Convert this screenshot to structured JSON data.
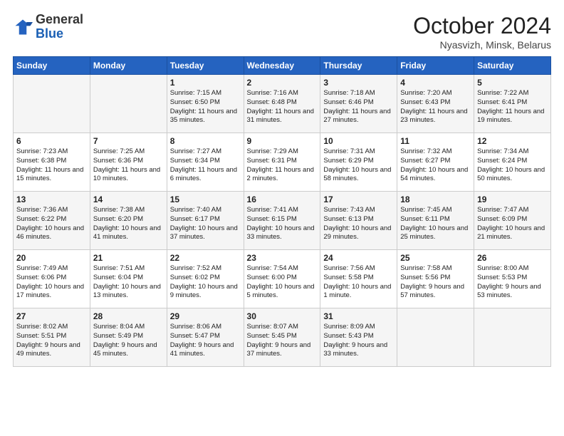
{
  "header": {
    "logo_general": "General",
    "logo_blue": "Blue",
    "month_title": "October 2024",
    "location": "Nyasvizh, Minsk, Belarus"
  },
  "days_of_week": [
    "Sunday",
    "Monday",
    "Tuesday",
    "Wednesday",
    "Thursday",
    "Friday",
    "Saturday"
  ],
  "weeks": [
    [
      {
        "day": "",
        "info": ""
      },
      {
        "day": "",
        "info": ""
      },
      {
        "day": "1",
        "info": "Sunrise: 7:15 AM\nSunset: 6:50 PM\nDaylight: 11 hours and 35 minutes."
      },
      {
        "day": "2",
        "info": "Sunrise: 7:16 AM\nSunset: 6:48 PM\nDaylight: 11 hours and 31 minutes."
      },
      {
        "day": "3",
        "info": "Sunrise: 7:18 AM\nSunset: 6:46 PM\nDaylight: 11 hours and 27 minutes."
      },
      {
        "day": "4",
        "info": "Sunrise: 7:20 AM\nSunset: 6:43 PM\nDaylight: 11 hours and 23 minutes."
      },
      {
        "day": "5",
        "info": "Sunrise: 7:22 AM\nSunset: 6:41 PM\nDaylight: 11 hours and 19 minutes."
      }
    ],
    [
      {
        "day": "6",
        "info": "Sunrise: 7:23 AM\nSunset: 6:38 PM\nDaylight: 11 hours and 15 minutes."
      },
      {
        "day": "7",
        "info": "Sunrise: 7:25 AM\nSunset: 6:36 PM\nDaylight: 11 hours and 10 minutes."
      },
      {
        "day": "8",
        "info": "Sunrise: 7:27 AM\nSunset: 6:34 PM\nDaylight: 11 hours and 6 minutes."
      },
      {
        "day": "9",
        "info": "Sunrise: 7:29 AM\nSunset: 6:31 PM\nDaylight: 11 hours and 2 minutes."
      },
      {
        "day": "10",
        "info": "Sunrise: 7:31 AM\nSunset: 6:29 PM\nDaylight: 10 hours and 58 minutes."
      },
      {
        "day": "11",
        "info": "Sunrise: 7:32 AM\nSunset: 6:27 PM\nDaylight: 10 hours and 54 minutes."
      },
      {
        "day": "12",
        "info": "Sunrise: 7:34 AM\nSunset: 6:24 PM\nDaylight: 10 hours and 50 minutes."
      }
    ],
    [
      {
        "day": "13",
        "info": "Sunrise: 7:36 AM\nSunset: 6:22 PM\nDaylight: 10 hours and 46 minutes."
      },
      {
        "day": "14",
        "info": "Sunrise: 7:38 AM\nSunset: 6:20 PM\nDaylight: 10 hours and 41 minutes."
      },
      {
        "day": "15",
        "info": "Sunrise: 7:40 AM\nSunset: 6:17 PM\nDaylight: 10 hours and 37 minutes."
      },
      {
        "day": "16",
        "info": "Sunrise: 7:41 AM\nSunset: 6:15 PM\nDaylight: 10 hours and 33 minutes."
      },
      {
        "day": "17",
        "info": "Sunrise: 7:43 AM\nSunset: 6:13 PM\nDaylight: 10 hours and 29 minutes."
      },
      {
        "day": "18",
        "info": "Sunrise: 7:45 AM\nSunset: 6:11 PM\nDaylight: 10 hours and 25 minutes."
      },
      {
        "day": "19",
        "info": "Sunrise: 7:47 AM\nSunset: 6:09 PM\nDaylight: 10 hours and 21 minutes."
      }
    ],
    [
      {
        "day": "20",
        "info": "Sunrise: 7:49 AM\nSunset: 6:06 PM\nDaylight: 10 hours and 17 minutes."
      },
      {
        "day": "21",
        "info": "Sunrise: 7:51 AM\nSunset: 6:04 PM\nDaylight: 10 hours and 13 minutes."
      },
      {
        "day": "22",
        "info": "Sunrise: 7:52 AM\nSunset: 6:02 PM\nDaylight: 10 hours and 9 minutes."
      },
      {
        "day": "23",
        "info": "Sunrise: 7:54 AM\nSunset: 6:00 PM\nDaylight: 10 hours and 5 minutes."
      },
      {
        "day": "24",
        "info": "Sunrise: 7:56 AM\nSunset: 5:58 PM\nDaylight: 10 hours and 1 minute."
      },
      {
        "day": "25",
        "info": "Sunrise: 7:58 AM\nSunset: 5:56 PM\nDaylight: 9 hours and 57 minutes."
      },
      {
        "day": "26",
        "info": "Sunrise: 8:00 AM\nSunset: 5:53 PM\nDaylight: 9 hours and 53 minutes."
      }
    ],
    [
      {
        "day": "27",
        "info": "Sunrise: 8:02 AM\nSunset: 5:51 PM\nDaylight: 9 hours and 49 minutes."
      },
      {
        "day": "28",
        "info": "Sunrise: 8:04 AM\nSunset: 5:49 PM\nDaylight: 9 hours and 45 minutes."
      },
      {
        "day": "29",
        "info": "Sunrise: 8:06 AM\nSunset: 5:47 PM\nDaylight: 9 hours and 41 minutes."
      },
      {
        "day": "30",
        "info": "Sunrise: 8:07 AM\nSunset: 5:45 PM\nDaylight: 9 hours and 37 minutes."
      },
      {
        "day": "31",
        "info": "Sunrise: 8:09 AM\nSunset: 5:43 PM\nDaylight: 9 hours and 33 minutes."
      },
      {
        "day": "",
        "info": ""
      },
      {
        "day": "",
        "info": ""
      }
    ]
  ]
}
